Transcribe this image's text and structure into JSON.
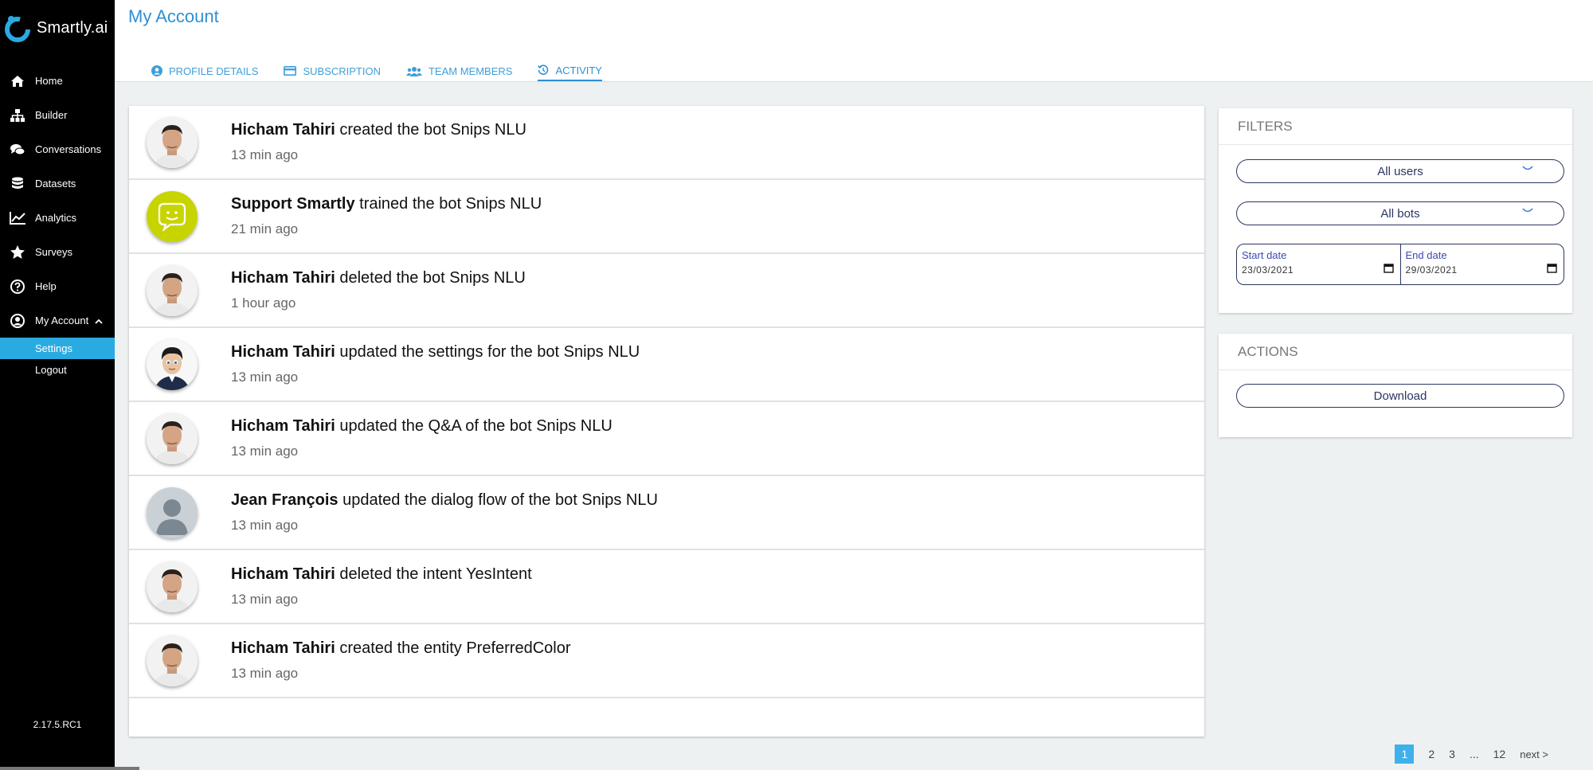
{
  "app": {
    "name": "Smartly.ai",
    "version": "2.17.5.RC1"
  },
  "sidebar": {
    "items": [
      {
        "label": "Home",
        "icon": "home-icon"
      },
      {
        "label": "Builder",
        "icon": "sitemap-icon"
      },
      {
        "label": "Conversations",
        "icon": "chat-icon"
      },
      {
        "label": "Datasets",
        "icon": "database-icon"
      },
      {
        "label": "Analytics",
        "icon": "chart-line-icon"
      },
      {
        "label": "Surveys",
        "icon": "star-icon"
      },
      {
        "label": "Help",
        "icon": "help-icon"
      },
      {
        "label": "My Account",
        "icon": "user-circle-icon"
      }
    ],
    "sub_items": [
      {
        "label": "Settings",
        "active": true
      },
      {
        "label": "Logout",
        "active": false
      }
    ]
  },
  "header": {
    "title": "My Account",
    "tabs": [
      {
        "label": "PROFILE DETAILS",
        "icon": "user-circle-icon"
      },
      {
        "label": "SUBSCRIPTION",
        "icon": "credit-card-icon"
      },
      {
        "label": "TEAM MEMBERS",
        "icon": "users-icon"
      },
      {
        "label": "ACTIVITY",
        "icon": "history-icon",
        "active": true
      }
    ]
  },
  "activity": [
    {
      "user": "Hicham Tahiri",
      "action": "created the bot Snips NLU",
      "time": "13 min ago",
      "avatar": "photo"
    },
    {
      "user": "Support Smartly",
      "action": "trained the bot Snips NLU",
      "time": "21 min ago",
      "avatar": "bot"
    },
    {
      "user": "Hicham Tahiri",
      "action": "deleted the bot Snips NLU",
      "time": "1 hour ago",
      "avatar": "photo"
    },
    {
      "user": "Hicham Tahiri",
      "action": "updated the settings for the bot Snips NLU",
      "time": "13 min ago",
      "avatar": "cartoon"
    },
    {
      "user": "Hicham Tahiri",
      "action": "updated the Q&A of the bot Snips NLU",
      "time": "13 min ago",
      "avatar": "photo"
    },
    {
      "user": "Jean François",
      "action": "updated the dialog flow of the bot Snips NLU",
      "time": "13 min ago",
      "avatar": "placeholder"
    },
    {
      "user": "Hicham Tahiri",
      "action": "deleted the intent YesIntent",
      "time": "13 min ago",
      "avatar": "photo"
    },
    {
      "user": "Hicham Tahiri",
      "action": "created the entity PreferredColor",
      "time": "13 min ago",
      "avatar": "photo"
    }
  ],
  "filters": {
    "title": "FILTERS",
    "users_select": "All users",
    "bots_select": "All bots",
    "start_label": "Start date",
    "start_value": "23/03/2021",
    "end_label": "End date",
    "end_value": "29/03/2021"
  },
  "actions": {
    "title": "ACTIONS",
    "download_label": "Download"
  },
  "pagination": {
    "pages": [
      "1",
      "2",
      "3",
      "...",
      "12"
    ],
    "current": "1",
    "next_label": "next >"
  },
  "colors": {
    "accent": "#2f8fd3",
    "sidebar_bg": "#000000",
    "active_sub": "#29abe2",
    "pill_border": "#2b3563",
    "bot_avatar": "#c8d400"
  }
}
